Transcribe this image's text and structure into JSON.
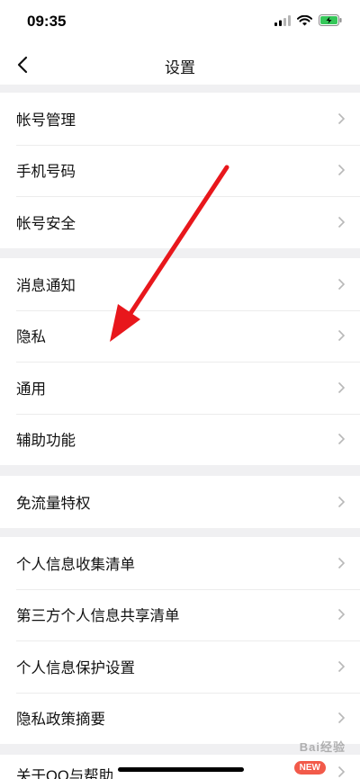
{
  "status_bar": {
    "time": "09:35",
    "icons": [
      "signal-icon",
      "wifi-icon",
      "battery-charging-icon"
    ]
  },
  "nav": {
    "title": "设置",
    "back_icon": "chevron-left-icon"
  },
  "groups": [
    {
      "items": [
        {
          "label": "帐号管理"
        },
        {
          "label": "手机号码"
        },
        {
          "label": "帐号安全"
        }
      ]
    },
    {
      "items": [
        {
          "label": "消息通知"
        },
        {
          "label": "隐私"
        },
        {
          "label": "通用"
        },
        {
          "label": "辅助功能"
        }
      ]
    },
    {
      "items": [
        {
          "label": "免流量特权"
        }
      ]
    },
    {
      "items": [
        {
          "label": "个人信息收集清单"
        },
        {
          "label": "第三方个人信息共享清单"
        },
        {
          "label": "个人信息保护设置"
        },
        {
          "label": "隐私政策摘要"
        }
      ]
    },
    {
      "items": [
        {
          "label": "关于QQ与帮助",
          "badge": "NEW"
        }
      ]
    }
  ],
  "watermark": "Bai经验",
  "colors": {
    "arrow": "#e8171c",
    "badge": "#f25a4a",
    "background": "#f0f0f2"
  }
}
